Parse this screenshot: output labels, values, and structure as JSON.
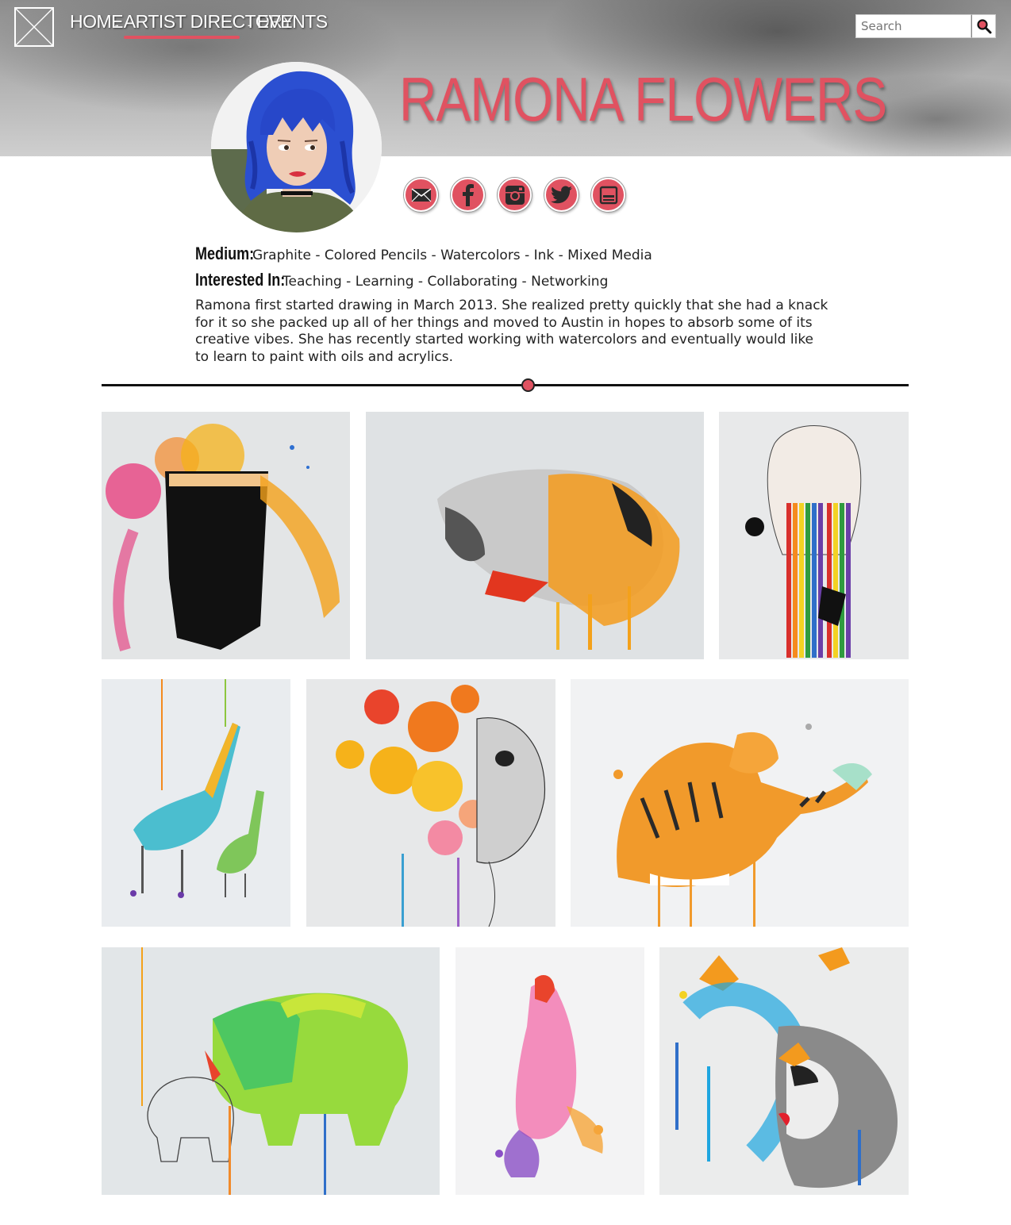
{
  "header": {
    "nav": [
      {
        "label": "HOME",
        "active": false
      },
      {
        "label": "ARTIST DIRECTORY",
        "active": true
      },
      {
        "label": "EVENTS",
        "active": false
      }
    ],
    "nav_separator": "-",
    "search": {
      "placeholder": "Search",
      "icon": "search-icon"
    }
  },
  "artist": {
    "name": "RAMONA FLOWERS",
    "avatar": "artist-portrait",
    "socials": [
      "email-icon",
      "facebook-icon",
      "instagram-icon",
      "twitter-icon",
      "portfolio-icon"
    ]
  },
  "info": {
    "medium_label": "Medium:",
    "medium_value": "Graphite - Colored Pencils - Watercolors - Ink - Mixed Media",
    "interests_label": "Interested In:",
    "interests_value": "Teaching - Learning - Collaborating - Networking",
    "bio": "Ramona first started drawing in March 2013. She realized pretty quickly that she had a knack for it so she packed up all of her things and moved to Austin in hopes to absorb some of its creative vibes. She has recently started working with watercolors and eventually would like to learn to paint with oils and acrylics."
  },
  "gallery": [
    "watercolor-veiled-woman",
    "watercolor-lioness",
    "watercolor-rainbow-tears",
    "watercolor-giraffes",
    "watercolor-flower-skull-woman",
    "watercolor-tiger",
    "watercolor-rhinos",
    "watercolor-hippo",
    "watercolor-butterfly-woman"
  ],
  "colors": {
    "accent": "#e05261",
    "text": "#222222"
  }
}
